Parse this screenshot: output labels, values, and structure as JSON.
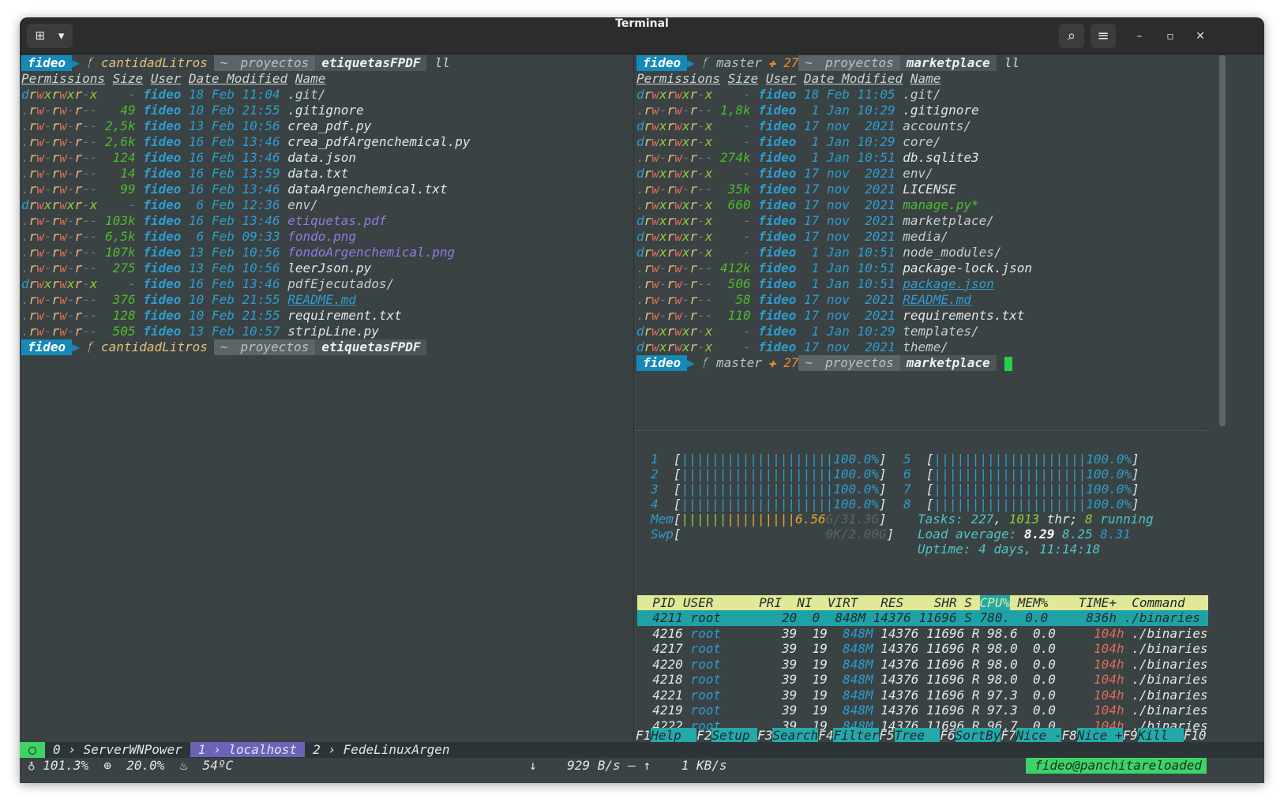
{
  "window": {
    "title": "Terminal",
    "new_tab_glyph": "⊞",
    "dropdown_glyph": "▾",
    "search_glyph": "⌕",
    "menu_glyph": "≡",
    "minimize_glyph": "–",
    "maximize_glyph": "▫",
    "close_glyph": "✕"
  },
  "left": {
    "prompt": {
      "user": "fideo",
      "branch": "ᚶ cantidadLitros",
      "home": "~",
      "dir1": "proyectos",
      "dir2": "etiquetasFPDF",
      "cmd": "ll"
    },
    "headers": [
      "Permissions",
      "Size",
      "User",
      "Date Modified",
      "Name"
    ],
    "rows": [
      {
        "perm": "drwxrwxr-x",
        "size": "-",
        "user": "fideo",
        "date": "18 Feb 11:04",
        "name": ".git/",
        "kind": "dir"
      },
      {
        "perm": ".rw-rw-r--",
        "size": "49",
        "user": "fideo",
        "date": "10 Feb 21:55",
        "name": ".gitignore",
        "kind": "file"
      },
      {
        "perm": ".rw-rw-r--",
        "size": "2,5k",
        "user": "fideo",
        "date": "13 Feb 10:56",
        "name": "crea_pdf.py",
        "kind": "file"
      },
      {
        "perm": ".rw-rw-r--",
        "size": "2,6k",
        "user": "fideo",
        "date": "16 Feb 13:46",
        "name": "crea_pdfArgenchemical.py",
        "kind": "file"
      },
      {
        "perm": ".rw-rw-r--",
        "size": "124",
        "user": "fideo",
        "date": "16 Feb 13:46",
        "name": "data.json",
        "kind": "file"
      },
      {
        "perm": ".rw-rw-r--",
        "size": "14",
        "user": "fideo",
        "date": "16 Feb 13:59",
        "name": "data.txt",
        "kind": "file"
      },
      {
        "perm": ".rw-rw-r--",
        "size": "99",
        "user": "fideo",
        "date": "16 Feb 13:46",
        "name": "dataArgenchemical.txt",
        "kind": "file"
      },
      {
        "perm": "drwxrwxr-x",
        "size": "-",
        "user": "fideo",
        "date": "6 Feb 12:36",
        "name": "env/",
        "kind": "dir"
      },
      {
        "perm": ".rw-rw-r--",
        "size": "103k",
        "user": "fideo",
        "date": "16 Feb 13:46",
        "name": "etiquetas.pdf",
        "kind": "media"
      },
      {
        "perm": ".rw-rw-r--",
        "size": "6,5k",
        "user": "fideo",
        "date": "6 Feb 09:33",
        "name": "fondo.png",
        "kind": "media"
      },
      {
        "perm": ".rw-rw-r--",
        "size": "107k",
        "user": "fideo",
        "date": "13 Feb 10:56",
        "name": "fondoArgenchemical.png",
        "kind": "media"
      },
      {
        "perm": ".rw-rw-r--",
        "size": "275",
        "user": "fideo",
        "date": "13 Feb 10:56",
        "name": "leerJson.py",
        "kind": "file"
      },
      {
        "perm": "drwxrwxr-x",
        "size": "-",
        "user": "fideo",
        "date": "16 Feb 13:46",
        "name": "pdfEjecutados/",
        "kind": "dir"
      },
      {
        "perm": ".rw-rw-r--",
        "size": "376",
        "user": "fideo",
        "date": "10 Feb 21:55",
        "name": "README.md",
        "kind": "link"
      },
      {
        "perm": ".rw-rw-r--",
        "size": "128",
        "user": "fideo",
        "date": "10 Feb 21:55",
        "name": "requirement.txt",
        "kind": "file"
      },
      {
        "perm": ".rw-rw-r--",
        "size": "505",
        "user": "fideo",
        "date": "13 Feb 10:57",
        "name": "stripLine.py",
        "kind": "file"
      }
    ]
  },
  "right": {
    "prompt": {
      "user": "fideo",
      "branch": "ᚶ master",
      "changes": "✚ 27",
      "home": "~",
      "dir1": "proyectos",
      "dir2": "marketplace",
      "cmd": "ll"
    },
    "headers": [
      "Permissions",
      "Size",
      "User",
      "Date Modified",
      "Name"
    ],
    "rows": [
      {
        "perm": "drwxrwxr-x",
        "size": "-",
        "user": "fideo",
        "date": "18 Feb 11:05",
        "name": ".git/",
        "kind": "dir"
      },
      {
        "perm": ".rw-rw-r--",
        "size": "1,8k",
        "user": "fideo",
        "date": " 1 Jan 10:29",
        "name": ".gitignore",
        "kind": "file"
      },
      {
        "perm": "drwxrwxr-x",
        "size": "-",
        "user": "fideo",
        "date": "17 nov  2021",
        "name": "accounts/",
        "kind": "dir"
      },
      {
        "perm": "drwxrwxr-x",
        "size": "-",
        "user": "fideo",
        "date": " 1 Jan 10:29",
        "name": "core/",
        "kind": "dir"
      },
      {
        "perm": ".rw-rw-r--",
        "size": "274k",
        "user": "fideo",
        "date": " 1 Jan 10:51",
        "name": "db.sqlite3",
        "kind": "file"
      },
      {
        "perm": "drwxrwxr-x",
        "size": "-",
        "user": "fideo",
        "date": "17 nov  2021",
        "name": "env/",
        "kind": "dir"
      },
      {
        "perm": ".rw-rw-r--",
        "size": "35k",
        "user": "fideo",
        "date": "17 nov  2021",
        "name": "LICENSE",
        "kind": "file"
      },
      {
        "perm": ".rwxrwxr-x",
        "size": "660",
        "user": "fideo",
        "date": "17 nov  2021",
        "name": "manage.py*",
        "kind": "exec"
      },
      {
        "perm": "drwxrwxr-x",
        "size": "-",
        "user": "fideo",
        "date": "17 nov  2021",
        "name": "marketplace/",
        "kind": "dir"
      },
      {
        "perm": "drwxrwxr-x",
        "size": "-",
        "user": "fideo",
        "date": "17 nov  2021",
        "name": "media/",
        "kind": "dir"
      },
      {
        "perm": "drwxrwxr-x",
        "size": "-",
        "user": "fideo",
        "date": " 1 Jan 10:51",
        "name": "node_modules/",
        "kind": "dir"
      },
      {
        "perm": ".rw-rw-r--",
        "size": "412k",
        "user": "fideo",
        "date": " 1 Jan 10:51",
        "name": "package-lock.json",
        "kind": "file"
      },
      {
        "perm": ".rw-rw-r--",
        "size": "506",
        "user": "fideo",
        "date": " 1 Jan 10:51",
        "name": "package.json",
        "kind": "link"
      },
      {
        "perm": ".rw-rw-r--",
        "size": "58",
        "user": "fideo",
        "date": "17 nov  2021",
        "name": "README.md",
        "kind": "link"
      },
      {
        "perm": ".rw-rw-r--",
        "size": "110",
        "user": "fideo",
        "date": "17 nov  2021",
        "name": "requirements.txt",
        "kind": "file"
      },
      {
        "perm": "drwxrwxr-x",
        "size": "-",
        "user": "fideo",
        "date": " 1 Jan 10:29",
        "name": "templates/",
        "kind": "dir"
      },
      {
        "perm": "drwxrwxr-x",
        "size": "-",
        "user": "fideo",
        "date": "17 nov  2021",
        "name": "theme/",
        "kind": "dir"
      }
    ]
  },
  "htop": {
    "cpus": [
      {
        "id": "1",
        "value": "100.0%"
      },
      {
        "id": "2",
        "value": "100.0%"
      },
      {
        "id": "3",
        "value": "100.0%"
      },
      {
        "id": "4",
        "value": "100.0%"
      },
      {
        "id": "5",
        "value": "100.0%"
      },
      {
        "id": "6",
        "value": "100.0%"
      },
      {
        "id": "7",
        "value": "100.0%"
      },
      {
        "id": "8",
        "value": "100.0%"
      }
    ],
    "cpu_bar": "||||||||||||||||||||",
    "mem_label": "Mem",
    "mem_bar_a": "||||||",
    "mem_bar_b": "|||||||||",
    "mem_used": "6.56",
    "mem_rest": "G/31.3G",
    "swp_label": "Swp",
    "swp_value": "0K/2.00G",
    "tasks_label": "Tasks:",
    "tasks": "227",
    "thr": "1013",
    "thr_label": "thr;",
    "running": "8",
    "running_label": "running",
    "load_label": "Load average:",
    "load1": "8.29",
    "load5": "8.25",
    "load15": "8.31",
    "uptime_label": "Uptime:",
    "uptime": "4 days, 11:14:18",
    "columns": [
      "PID",
      "USER",
      "PRI",
      "NI",
      "VIRT",
      "RES",
      "SHR",
      "S",
      "CPU%",
      "MEM%",
      "TIME+",
      "Command"
    ],
    "procs": [
      {
        "pid": "4211",
        "user": "root",
        "pri": "20",
        "ni": "0",
        "virt": "848M",
        "res": "14376",
        "shr": "11696",
        "s": "S",
        "cpu": "780.",
        "mem": "0.0",
        "time": "836h",
        "cmd": "./binaries"
      },
      {
        "pid": "4216",
        "user": "root",
        "pri": "39",
        "ni": "19",
        "virt": "848M",
        "res": "14376",
        "shr": "11696",
        "s": "R",
        "cpu": "98.6",
        "mem": "0.0",
        "time": "104h",
        "cmd": "./binaries"
      },
      {
        "pid": "4217",
        "user": "root",
        "pri": "39",
        "ni": "19",
        "virt": "848M",
        "res": "14376",
        "shr": "11696",
        "s": "R",
        "cpu": "98.0",
        "mem": "0.0",
        "time": "104h",
        "cmd": "./binaries"
      },
      {
        "pid": "4220",
        "user": "root",
        "pri": "39",
        "ni": "19",
        "virt": "848M",
        "res": "14376",
        "shr": "11696",
        "s": "R",
        "cpu": "98.0",
        "mem": "0.0",
        "time": "104h",
        "cmd": "./binaries"
      },
      {
        "pid": "4218",
        "user": "root",
        "pri": "39",
        "ni": "19",
        "virt": "848M",
        "res": "14376",
        "shr": "11696",
        "s": "R",
        "cpu": "98.0",
        "mem": "0.0",
        "time": "104h",
        "cmd": "./binaries"
      },
      {
        "pid": "4221",
        "user": "root",
        "pri": "39",
        "ni": "19",
        "virt": "848M",
        "res": "14376",
        "shr": "11696",
        "s": "R",
        "cpu": "97.3",
        "mem": "0.0",
        "time": "104h",
        "cmd": "./binaries"
      },
      {
        "pid": "4219",
        "user": "root",
        "pri": "39",
        "ni": "19",
        "virt": "848M",
        "res": "14376",
        "shr": "11696",
        "s": "R",
        "cpu": "97.3",
        "mem": "0.0",
        "time": "104h",
        "cmd": "./binaries"
      },
      {
        "pid": "4222",
        "user": "root",
        "pri": "39",
        "ni": "19",
        "virt": "848M",
        "res": "14376",
        "shr": "11696",
        "s": "R",
        "cpu": "96.7",
        "mem": "0.0",
        "time": "104h",
        "cmd": "./binaries"
      }
    ],
    "fkeys": [
      {
        "key": "F1",
        "label": "Help  "
      },
      {
        "key": "F2",
        "label": "Setup "
      },
      {
        "key": "F3",
        "label": "Search"
      },
      {
        "key": "F4",
        "label": "Filter"
      },
      {
        "key": "F5",
        "label": "Tree  "
      },
      {
        "key": "F6",
        "label": "SortBy"
      },
      {
        "key": "F7",
        "label": "Nice -"
      },
      {
        "key": "F8",
        "label": "Nice +"
      },
      {
        "key": "F9",
        "label": "Kill  "
      },
      {
        "key": "F10",
        "label": ""
      }
    ]
  },
  "tmux": {
    "session_icon": "◯",
    "windows": [
      {
        "index": "0",
        "name": "ServerWNPower",
        "active": false
      },
      {
        "index": "1",
        "name": "localhost",
        "active": true
      },
      {
        "index": "2",
        "name": "FedeLinuxArgen",
        "active": false
      }
    ],
    "arrow": "›",
    "cpu_icon": "♁",
    "cpu": "101.3%",
    "ram_icon": "⊕",
    "ram": "20.0%",
    "temp_icon": "♨",
    "temp": "54ºC",
    "down_arrow": "↓",
    "down": "929 B/s",
    "sep": "–",
    "up_arrow": "↑",
    "up": "1 KB/s",
    "host": "fideo@panchitareloaded"
  }
}
